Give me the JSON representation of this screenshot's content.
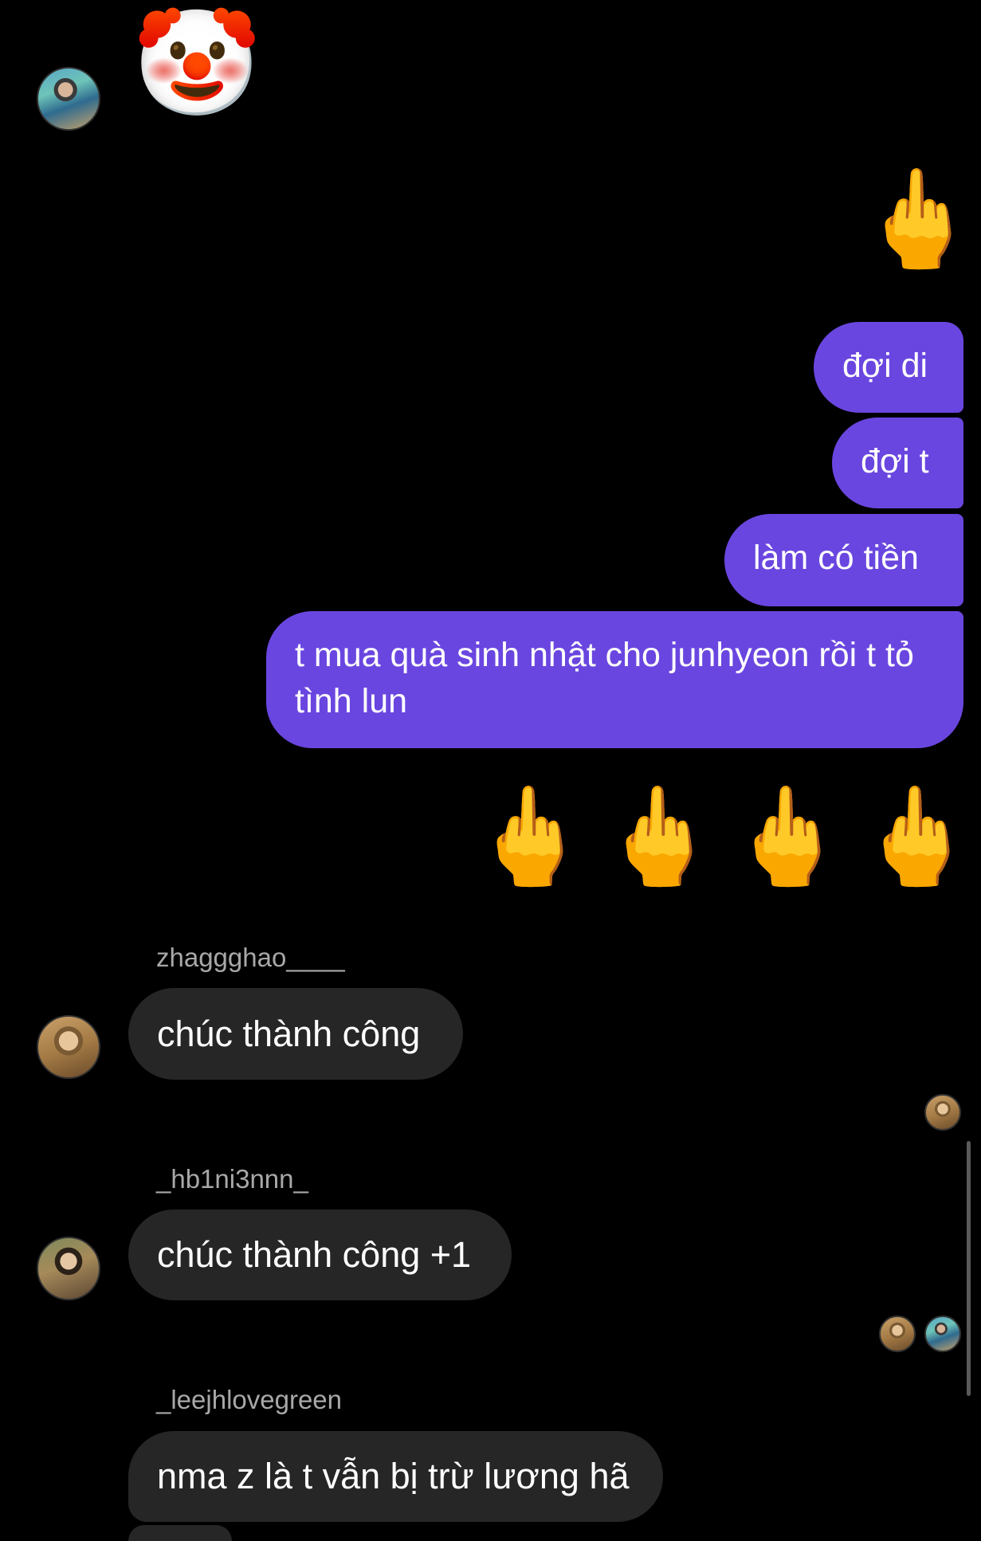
{
  "messages": {
    "clown_emoji": "🤡",
    "finger_emoji": "🖕",
    "outgoing": [
      {
        "text": "đợi di"
      },
      {
        "text": "đợi t"
      },
      {
        "text": "làm có tiền"
      },
      {
        "text": "t mua quà sinh nhật cho junhyeon rồi t tỏ tình lun"
      }
    ],
    "incoming": [
      {
        "username": "zhaggghao____",
        "text": "chúc thành công"
      },
      {
        "username": "_hb1ni3nnn_",
        "text": "chúc thành công +1"
      },
      {
        "username": "_leejhlovegreen",
        "text": "nma z là t vẫn bị trừ lương hã"
      }
    ]
  },
  "colors": {
    "background": "#000000",
    "outgoing_bubble": "#6a46e0",
    "incoming_bubble": "#262626",
    "username": "#a8a8a8"
  }
}
